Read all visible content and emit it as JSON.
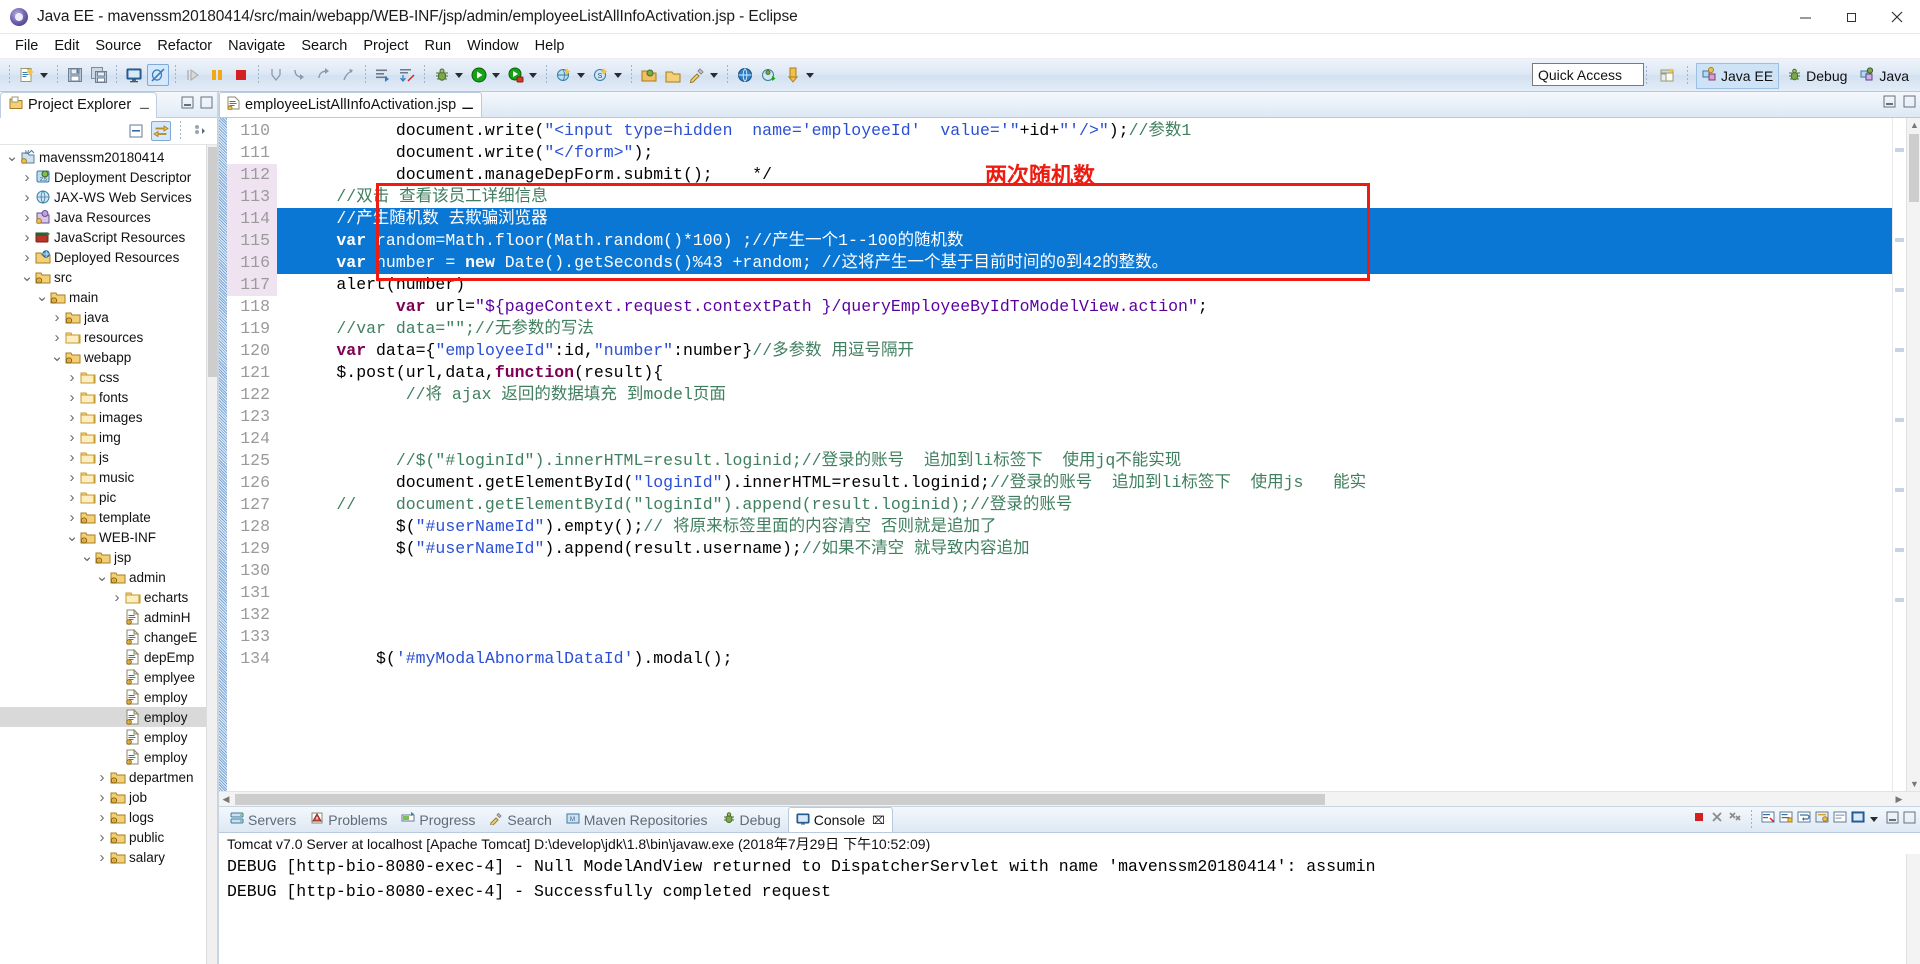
{
  "window": {
    "title": "Java EE - mavenssm20180414/src/main/webapp/WEB-INF/jsp/admin/employeeListAllInfoActivation.jsp - Eclipse",
    "minimize_label": "Minimize",
    "maximize_label": "Restore",
    "close_label": "Close"
  },
  "menu": {
    "items": [
      "File",
      "Edit",
      "Source",
      "Refactor",
      "Navigate",
      "Search",
      "Project",
      "Run",
      "Window",
      "Help"
    ]
  },
  "toolbar": {
    "quick_access_placeholder": "Quick Access",
    "quick_access_value": "Quick Access",
    "icons": [
      "new-wizard-icon",
      "new-dropdown-arrow",
      "save-icon",
      "save-all-icon",
      "console-view-icon",
      "no-debug-icon",
      "resume-icon",
      "suspend-icon",
      "terminate-icon",
      "step-into-selection-icon",
      "step-into-icon",
      "step-over-icon",
      "step-return-icon",
      "open-task-icon",
      "skip-breakpoints-icon",
      "debug-icon",
      "debug-dropdown-arrow",
      "run-icon",
      "run-dropdown-arrow",
      "run-coverage-icon",
      "coverage-dropdown-arrow",
      "new-java-project-icon",
      "java-dropdown-arrow",
      "new-js-icon",
      "js-dropdown-arrow",
      "open-type-icon",
      "open-task-icon2",
      "search-icon",
      "search-dropdown-arrow",
      "web-browser-icon",
      "run-server-icon",
      "profile-icon",
      "profile-dropdown-arrow"
    ],
    "perspectives": [
      {
        "label": "Java EE",
        "icon": "java-ee-perspective-icon",
        "selected": true
      },
      {
        "label": "Debug",
        "icon": "debug-perspective-icon",
        "selected": false
      },
      {
        "label": "Java",
        "icon": "java-perspective-icon",
        "selected": false
      }
    ],
    "open_perspective_label": "Open Perspective"
  },
  "explorer": {
    "tab_label": "Project Explorer",
    "view_icons": [
      "collapse-all-icon",
      "link-with-editor-icon",
      "view-menu-icon"
    ],
    "tree": [
      {
        "depth": 0,
        "twist": "v",
        "icon": "maven-project-icon",
        "label": "mavenssm20180414",
        "selected": false
      },
      {
        "depth": 1,
        "twist": ">",
        "icon": "deployment-descriptor-icon",
        "label": "Deployment Descriptor",
        "selected": false
      },
      {
        "depth": 1,
        "twist": ">",
        "icon": "jaxws-icon",
        "label": "JAX-WS Web Services",
        "selected": false
      },
      {
        "depth": 1,
        "twist": ">",
        "icon": "java-resources-icon",
        "label": "Java Resources",
        "selected": false
      },
      {
        "depth": 1,
        "twist": ">",
        "icon": "javascript-resources-icon",
        "label": "JavaScript Resources",
        "selected": false
      },
      {
        "depth": 1,
        "twist": ">",
        "icon": "deployed-resources-icon",
        "label": "Deployed Resources",
        "selected": false
      },
      {
        "depth": 1,
        "twist": "v",
        "icon": "source-folder-icon",
        "label": "src",
        "selected": false
      },
      {
        "depth": 2,
        "twist": "v",
        "icon": "source-folder-icon",
        "label": "main",
        "selected": false
      },
      {
        "depth": 3,
        "twist": ">",
        "icon": "source-folder-icon",
        "label": "java",
        "selected": false
      },
      {
        "depth": 3,
        "twist": ">",
        "icon": "folder-icon",
        "label": "resources",
        "selected": false
      },
      {
        "depth": 3,
        "twist": "v",
        "icon": "source-folder-icon",
        "label": "webapp",
        "selected": false
      },
      {
        "depth": 4,
        "twist": ">",
        "icon": "folder-icon",
        "label": "css",
        "selected": false
      },
      {
        "depth": 4,
        "twist": ">",
        "icon": "folder-icon",
        "label": "fonts",
        "selected": false
      },
      {
        "depth": 4,
        "twist": ">",
        "icon": "folder-icon",
        "label": "images",
        "selected": false
      },
      {
        "depth": 4,
        "twist": ">",
        "icon": "folder-icon",
        "label": "img",
        "selected": false
      },
      {
        "depth": 4,
        "twist": ">",
        "icon": "folder-icon",
        "label": "js",
        "selected": false
      },
      {
        "depth": 4,
        "twist": ">",
        "icon": "folder-icon",
        "label": "music",
        "selected": false
      },
      {
        "depth": 4,
        "twist": ">",
        "icon": "folder-icon",
        "label": "pic",
        "selected": false
      },
      {
        "depth": 4,
        "twist": ">",
        "icon": "source-folder-icon",
        "label": "template",
        "selected": false
      },
      {
        "depth": 4,
        "twist": "v",
        "icon": "source-folder-icon",
        "label": "WEB-INF",
        "selected": false
      },
      {
        "depth": 5,
        "twist": "v",
        "icon": "source-folder-icon",
        "label": "jsp",
        "selected": false
      },
      {
        "depth": 6,
        "twist": "v",
        "icon": "source-folder-icon",
        "label": "admin",
        "selected": false
      },
      {
        "depth": 7,
        "twist": ">",
        "icon": "folder-icon",
        "label": "echarts",
        "selected": false
      },
      {
        "depth": 7,
        "twist": "",
        "icon": "jsp-file-icon",
        "label": "adminH",
        "selected": false
      },
      {
        "depth": 7,
        "twist": "",
        "icon": "jsp-file-icon",
        "label": "changeE",
        "selected": false
      },
      {
        "depth": 7,
        "twist": "",
        "icon": "jsp-file-icon",
        "label": "depEmp",
        "selected": false
      },
      {
        "depth": 7,
        "twist": "",
        "icon": "jsp-file-icon",
        "label": "emplyee",
        "selected": false
      },
      {
        "depth": 7,
        "twist": "",
        "icon": "jsp-file-icon",
        "label": "employ",
        "selected": false
      },
      {
        "depth": 7,
        "twist": "",
        "icon": "jsp-file-icon",
        "label": "employ",
        "selected": true
      },
      {
        "depth": 7,
        "twist": "",
        "icon": "jsp-file-icon",
        "label": "employ",
        "selected": false
      },
      {
        "depth": 7,
        "twist": "",
        "icon": "jsp-file-icon",
        "label": "employ",
        "selected": false
      },
      {
        "depth": 6,
        "twist": ">",
        "icon": "source-folder-icon",
        "label": "departmen",
        "selected": false
      },
      {
        "depth": 6,
        "twist": ">",
        "icon": "source-folder-icon",
        "label": "job",
        "selected": false
      },
      {
        "depth": 6,
        "twist": ">",
        "icon": "source-folder-icon",
        "label": "logs",
        "selected": false
      },
      {
        "depth": 6,
        "twist": ">",
        "icon": "source-folder-icon",
        "label": "public",
        "selected": false
      },
      {
        "depth": 6,
        "twist": ">",
        "icon": "source-folder-icon",
        "label": "salary",
        "selected": false
      }
    ]
  },
  "editor": {
    "tab_label": "employeeListAllInfoActivation.jsp",
    "tab_icon": "jsp-file-icon",
    "tab_close_label": "Close",
    "ctrl_icons": [
      "minimize-icon",
      "maximize-icon"
    ],
    "first_line_number": 110,
    "lines": [
      {
        "n": 110,
        "selected": false,
        "hl": false,
        "tokens": [
          {
            "t": "            document.write(",
            "c": ""
          },
          {
            "t": "\"<input type=hidden  name='employeeId'  value='\"",
            "c": "tk-str"
          },
          {
            "t": "+id+",
            "c": ""
          },
          {
            "t": "\"'/>\"",
            "c": "tk-str"
          },
          {
            "t": ");",
            "c": ""
          },
          {
            "t": "//参数1",
            "c": "tk-cmt"
          }
        ]
      },
      {
        "n": 111,
        "selected": false,
        "hl": false,
        "tokens": [
          {
            "t": "            document.write(",
            "c": ""
          },
          {
            "t": "\"</form>\"",
            "c": "tk-str"
          },
          {
            "t": ");",
            "c": ""
          }
        ]
      },
      {
        "n": 112,
        "selected": false,
        "hl": true,
        "tokens": [
          {
            "t": "            document.manageDepForm.submit();    */",
            "c": ""
          }
        ]
      },
      {
        "n": 113,
        "selected": false,
        "hl": true,
        "tokens": [
          {
            "t": "      //双击 查看该员工详细信息",
            "c": "tk-cmt"
          }
        ]
      },
      {
        "n": 114,
        "selected": true,
        "hl": true,
        "tokens": [
          {
            "t": "      //产生随机数 去欺骗浏览器",
            "c": "tk-cmt"
          }
        ]
      },
      {
        "n": 115,
        "selected": true,
        "hl": true,
        "tokens": [
          {
            "t": "      var",
            "c": "tk-kw"
          },
          {
            "t": " random=Math.floor(Math.random()*100) ;",
            "c": ""
          },
          {
            "t": "//产生一个1--100的随机数",
            "c": "tk-cmt"
          }
        ]
      },
      {
        "n": 116,
        "selected": true,
        "hl": true,
        "tokens": [
          {
            "t": "      var",
            "c": "tk-kw"
          },
          {
            "t": " number = ",
            "c": ""
          },
          {
            "t": "new",
            "c": "tk-kw"
          },
          {
            "t": " Date().getSeconds()%43 +random; ",
            "c": ""
          },
          {
            "t": "//这将产生一个基于目前时间的0到42的整数。",
            "c": "tk-cmt"
          }
        ]
      },
      {
        "n": 117,
        "selected": false,
        "hl": true,
        "tokens": [
          {
            "t": "      alert(number)",
            "c": ""
          }
        ]
      },
      {
        "n": 118,
        "selected": false,
        "hl": false,
        "tokens": [
          {
            "t": "            var",
            "c": "tk-kw"
          },
          {
            "t": " url=",
            "c": ""
          },
          {
            "t": "\"${pageContext.request.contextPath }/queryEmployeeByIdToModelView.action\"",
            "c": "tk-jsp"
          },
          {
            "t": ";",
            "c": ""
          }
        ]
      },
      {
        "n": 119,
        "selected": false,
        "hl": false,
        "tokens": [
          {
            "t": "      //var data=\"\";//无参数的写法",
            "c": "tk-cmt"
          }
        ]
      },
      {
        "n": 120,
        "selected": false,
        "hl": false,
        "tokens": [
          {
            "t": "      var",
            "c": "tk-kw"
          },
          {
            "t": " data={",
            "c": ""
          },
          {
            "t": "\"employeeId\"",
            "c": "tk-str"
          },
          {
            "t": ":id,",
            "c": ""
          },
          {
            "t": "\"number\"",
            "c": "tk-str"
          },
          {
            "t": ":number}",
            "c": ""
          },
          {
            "t": "//多参数 用逗号隔开",
            "c": "tk-cmt"
          }
        ]
      },
      {
        "n": 121,
        "selected": false,
        "hl": false,
        "tokens": [
          {
            "t": "      $.post(url,data,",
            "c": ""
          },
          {
            "t": "function",
            "c": "tk-kw"
          },
          {
            "t": "(result){",
            "c": ""
          }
        ]
      },
      {
        "n": 122,
        "selected": false,
        "hl": false,
        "tokens": [
          {
            "t": "             //将 ajax 返回的数据填充 到model页面",
            "c": "tk-cmt"
          }
        ]
      },
      {
        "n": 123,
        "selected": false,
        "hl": false,
        "tokens": [
          {
            "t": "",
            "c": ""
          }
        ]
      },
      {
        "n": 124,
        "selected": false,
        "hl": false,
        "tokens": [
          {
            "t": "",
            "c": ""
          }
        ]
      },
      {
        "n": 125,
        "selected": false,
        "hl": false,
        "tokens": [
          {
            "t": "            //$(\"#loginId\").innerHTML=result.loginid;//登录的账号  追加到li标签下  使用jq不能实现",
            "c": "tk-cmt"
          }
        ]
      },
      {
        "n": 126,
        "selected": false,
        "hl": false,
        "tokens": [
          {
            "t": "            document.getElementById(",
            "c": ""
          },
          {
            "t": "\"loginId\"",
            "c": "tk-str"
          },
          {
            "t": ").innerHTML=result.loginid;",
            "c": ""
          },
          {
            "t": "//登录的账号  追加到li标签下  使用js   能实",
            "c": "tk-cmt"
          }
        ]
      },
      {
        "n": 127,
        "selected": false,
        "hl": false,
        "tokens": [
          {
            "t": "      //    document.getElementById(\"loginId\").append(result.loginid);//登录的账号",
            "c": "tk-cmt"
          }
        ]
      },
      {
        "n": 128,
        "selected": false,
        "hl": false,
        "tokens": [
          {
            "t": "            $(",
            "c": ""
          },
          {
            "t": "\"#userNameId\"",
            "c": "tk-str"
          },
          {
            "t": ").empty();",
            "c": ""
          },
          {
            "t": "// 将原来标签里面的内容清空 否则就是追加了",
            "c": "tk-cmt"
          }
        ]
      },
      {
        "n": 129,
        "selected": false,
        "hl": false,
        "tokens": [
          {
            "t": "            $(",
            "c": ""
          },
          {
            "t": "\"#userNameId\"",
            "c": "tk-str"
          },
          {
            "t": ").append(result.username);",
            "c": ""
          },
          {
            "t": "//如果不清空 就导致内容追加",
            "c": "tk-cmt"
          }
        ]
      },
      {
        "n": 130,
        "selected": false,
        "hl": false,
        "tokens": [
          {
            "t": "",
            "c": ""
          }
        ]
      },
      {
        "n": 131,
        "selected": false,
        "hl": false,
        "tokens": [
          {
            "t": "",
            "c": ""
          }
        ]
      },
      {
        "n": 132,
        "selected": false,
        "hl": false,
        "tokens": [
          {
            "t": "",
            "c": ""
          }
        ]
      },
      {
        "n": 133,
        "selected": false,
        "hl": false,
        "tokens": [
          {
            "t": "",
            "c": ""
          }
        ]
      },
      {
        "n": 134,
        "selected": false,
        "hl": false,
        "tokens": [
          {
            "t": "          $(",
            "c": ""
          },
          {
            "t": "'#myModalAbnormalDataId'",
            "c": "tk-str"
          },
          {
            "t": ").modal();",
            "c": ""
          }
        ]
      }
    ],
    "annotation": {
      "label": "两次随机数",
      "color": "#ee1b11"
    }
  },
  "console": {
    "tabs": [
      {
        "label": "Servers",
        "icon": "servers-icon",
        "selected": false
      },
      {
        "label": "Problems",
        "icon": "problems-icon",
        "selected": false
      },
      {
        "label": "Progress",
        "icon": "progress-icon",
        "selected": false
      },
      {
        "label": "Search",
        "icon": "search-icon",
        "selected": false
      },
      {
        "label": "Maven Repositories",
        "icon": "maven-icon",
        "selected": false
      },
      {
        "label": "Debug",
        "icon": "debug-icon",
        "selected": false
      },
      {
        "label": "Console",
        "icon": "console-icon",
        "selected": true
      }
    ],
    "ctrl_icons": [
      "terminate-icon",
      "remove-launch-icon",
      "remove-all-icon",
      "clear-console-icon",
      "scroll-lock-icon",
      "word-wrap-icon",
      "pin-console-icon",
      "display-console-icon",
      "open-console-icon",
      "console-dropdown-arrow",
      "minimize-icon",
      "maximize-icon"
    ],
    "header": "Tomcat v7.0 Server at localhost [Apache Tomcat] D:\\develop\\jdk\\1.8\\bin\\javaw.exe (2018年7月29日 下午10:52:09)",
    "lines": [
      "DEBUG [http-bio-8080-exec-4] - Null ModelAndView returned to DispatcherServlet with name 'mavenssm20180414': assumin",
      "DEBUG [http-bio-8080-exec-4] - Successfully completed request"
    ]
  },
  "colors": {
    "selection_blue": "#0a77d5",
    "annotation_red": "#ee1b11",
    "keyword_purple": "#7f0055",
    "string_blue": "#2a4fd6",
    "comment_green": "#3f7f5f"
  }
}
